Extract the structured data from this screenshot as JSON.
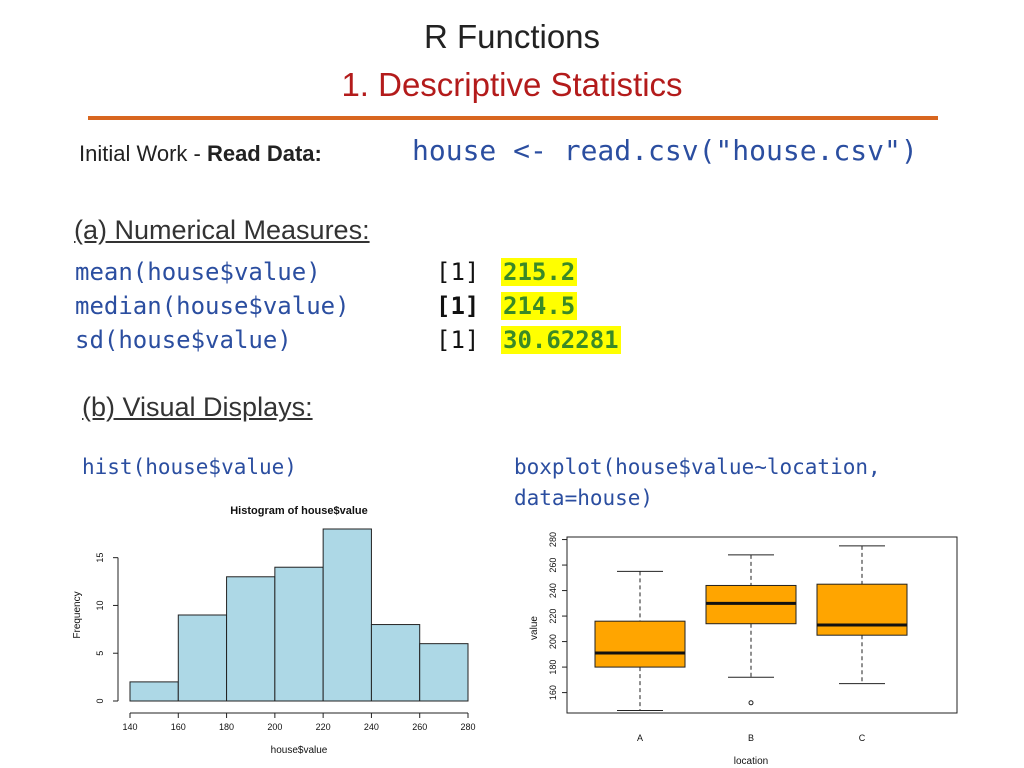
{
  "header": {
    "title": "R Functions",
    "subtitle": "1. Descriptive Statistics"
  },
  "initial_work": {
    "label": "Initial Work - ",
    "bold_label": "Read Data:",
    "code": "house <- read.csv(\"house.csv\")"
  },
  "numerical": {
    "heading": "(a) Numerical Measures:",
    "rows": [
      {
        "fn": "mean(house$value)",
        "index": "[1]",
        "value": "215.2"
      },
      {
        "fn": "median(house$value)",
        "index": "[1]",
        "value": "214.5"
      },
      {
        "fn": "sd(house$value)",
        "index": "[1]",
        "value": "30.62281"
      }
    ]
  },
  "visual": {
    "heading": "(b) Visual Displays:",
    "hist_code": "hist(house$value)",
    "box_code_line1": "boxplot(house$value~location,",
    "box_code_line2": "data=house)"
  },
  "colors": {
    "title_red": "#b31b1b",
    "rule_orange": "#d8661f",
    "code_blue": "#2b4ea0",
    "value_green": "#3a8a27",
    "highlight_yellow": "#ffff00",
    "hist_fill": "#add8e6",
    "box_fill": "#ffa500"
  },
  "chart_data": [
    {
      "type": "bar",
      "title": "Histogram of house$value",
      "xlabel": "house$value",
      "ylabel": "Frequency",
      "bins": [
        [
          140,
          160
        ],
        [
          160,
          180
        ],
        [
          180,
          200
        ],
        [
          200,
          220
        ],
        [
          220,
          240
        ],
        [
          240,
          260
        ],
        [
          260,
          280
        ]
      ],
      "values": [
        2,
        9,
        13,
        14,
        18,
        8,
        6
      ],
      "xticks": [
        140,
        160,
        180,
        200,
        220,
        240,
        260,
        280
      ],
      "yticks": [
        0,
        5,
        10,
        15
      ],
      "xlim": [
        140,
        280
      ],
      "ylim": [
        0,
        18
      ]
    },
    {
      "type": "box",
      "xlabel": "location",
      "ylabel": "value",
      "categories": [
        "A",
        "B",
        "C"
      ],
      "boxes": [
        {
          "name": "A",
          "whisker_low": 146,
          "q1": 180,
          "median": 191,
          "q3": 216,
          "whisker_high": 255,
          "outliers": []
        },
        {
          "name": "B",
          "whisker_low": 172,
          "q1": 214,
          "median": 230,
          "q3": 244,
          "whisker_high": 268,
          "outliers": [
            152
          ]
        },
        {
          "name": "C",
          "whisker_low": 167,
          "q1": 205,
          "median": 213,
          "q3": 245,
          "whisker_high": 275,
          "outliers": []
        }
      ],
      "yticks": [
        160,
        180,
        200,
        220,
        240,
        260,
        280
      ],
      "ylim": [
        144,
        282
      ]
    }
  ]
}
